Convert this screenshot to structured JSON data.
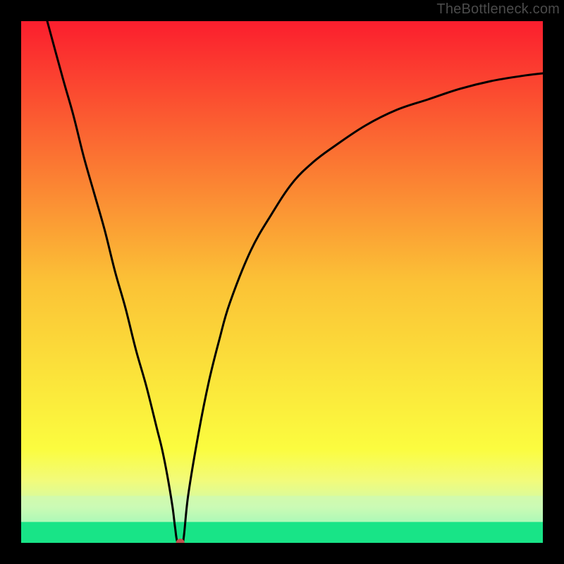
{
  "watermark": "TheBottleneck.com",
  "chart_data": {
    "type": "line",
    "title": "",
    "xlabel": "",
    "ylabel": "",
    "xlim": [
      0,
      100
    ],
    "ylim": [
      0,
      100
    ],
    "x": [
      5,
      8,
      10,
      12,
      14,
      16,
      18,
      20,
      22,
      24,
      26,
      27,
      28,
      29,
      29.5,
      30,
      31,
      32,
      34,
      36,
      38,
      40,
      44,
      48,
      52,
      56,
      60,
      66,
      72,
      78,
      84,
      90,
      96,
      100
    ],
    "values": [
      100,
      89,
      82,
      74,
      67,
      60,
      52,
      45,
      37,
      30,
      22,
      18,
      13,
      7,
      3,
      0,
      0,
      9,
      21,
      31,
      39,
      46,
      56,
      63,
      69,
      73,
      76,
      80,
      83,
      85,
      87,
      88.5,
      89.5,
      90
    ],
    "marker": {
      "x": 30.5,
      "y": 0,
      "color": "#c0524d",
      "radius": 6
    },
    "green_band": {
      "y0": 0,
      "y1": 4
    },
    "pale_green_band": {
      "y0": 4,
      "y1": 9
    },
    "gradient_stops": [
      {
        "offset": 0,
        "color": "#fb1e2e"
      },
      {
        "offset": 25,
        "color": "#fb7032"
      },
      {
        "offset": 50,
        "color": "#fbc236"
      },
      {
        "offset": 70,
        "color": "#fbe73b"
      },
      {
        "offset": 82,
        "color": "#fbfc3f"
      },
      {
        "offset": 88,
        "color": "#f2fb7a"
      },
      {
        "offset": 93,
        "color": "#d0fbaa"
      },
      {
        "offset": 96,
        "color": "#8ef8b0"
      },
      {
        "offset": 100,
        "color": "#18e487"
      }
    ]
  }
}
